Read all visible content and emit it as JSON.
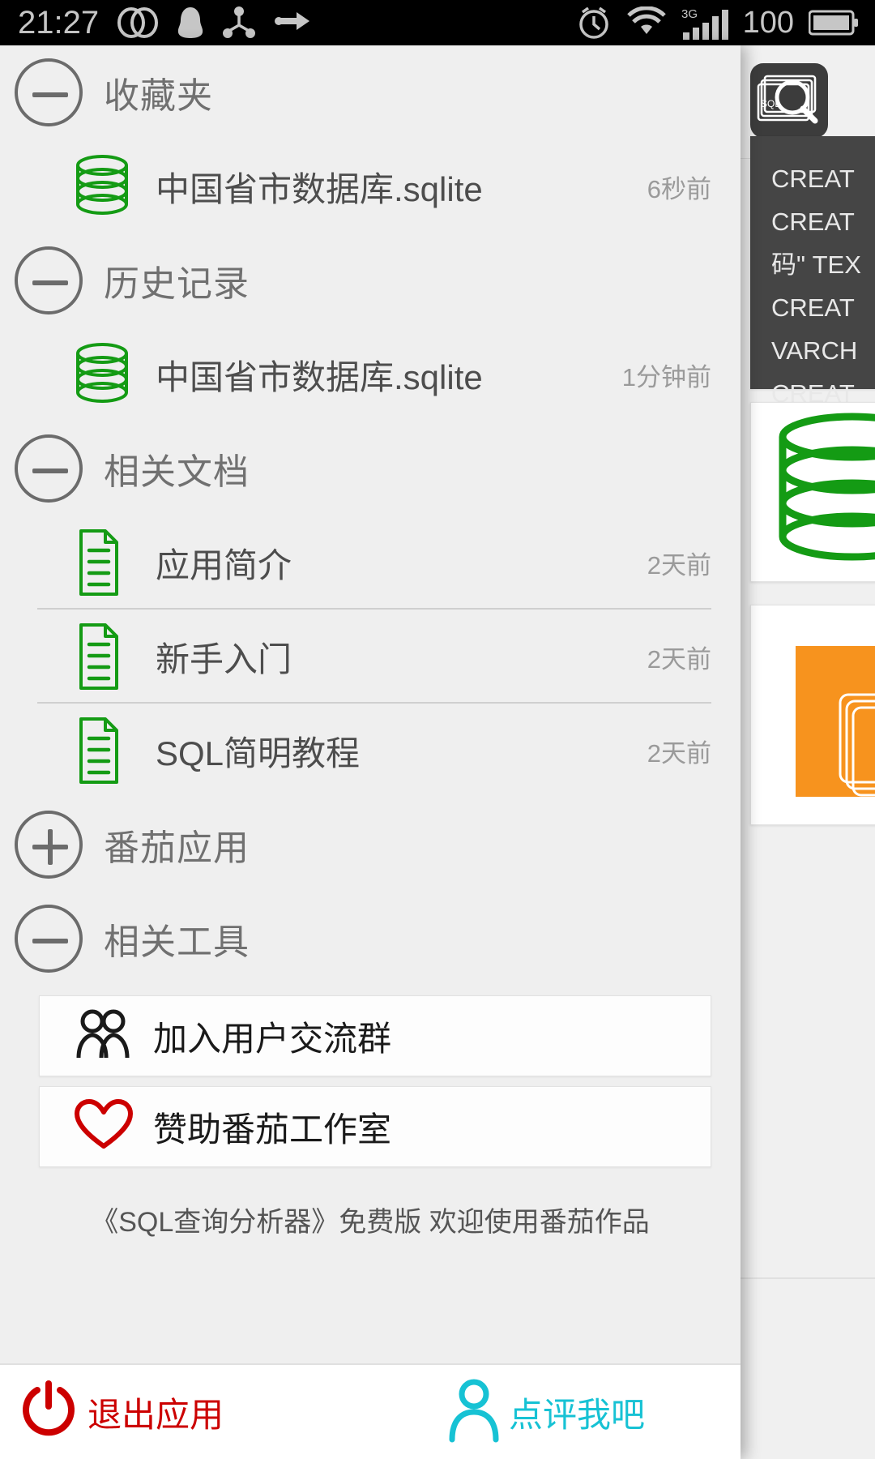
{
  "statusbar": {
    "time": "21:27",
    "battery_percent": "100",
    "network_type": "3G",
    "left_icons": [
      "dual-circle-icon",
      "qq-penguin-icon",
      "share-node-icon",
      "usb-transfer-icon"
    ],
    "right_icons": [
      "alarm-clock-icon",
      "wifi-icon",
      "signal-bars-icon",
      "battery-icon"
    ]
  },
  "drawer": {
    "groups": [
      {
        "id": "favorites",
        "title": "收藏夹",
        "toggle": "minus",
        "items": [
          {
            "icon": "database-icon",
            "label": "中国省市数据库.sqlite",
            "time": "6秒前",
            "separator": false
          }
        ]
      },
      {
        "id": "history",
        "title": "历史记录",
        "toggle": "minus",
        "items": [
          {
            "icon": "database-icon",
            "label": "中国省市数据库.sqlite",
            "time": "1分钟前",
            "separator": false
          }
        ]
      },
      {
        "id": "documents",
        "title": "相关文档",
        "toggle": "minus",
        "items": [
          {
            "icon": "document-icon",
            "label": "应用简介",
            "time": "2天前",
            "separator": true
          },
          {
            "icon": "document-icon",
            "label": "新手入门",
            "time": "2天前",
            "separator": true
          },
          {
            "icon": "document-icon",
            "label": "SQL简明教程",
            "time": "2天前",
            "separator": false
          }
        ]
      },
      {
        "id": "tomato-apps",
        "title": "番茄应用",
        "toggle": "plus",
        "items": []
      },
      {
        "id": "tools",
        "title": "相关工具",
        "toggle": "minus",
        "items": []
      }
    ],
    "tool_buttons": [
      {
        "icon": "two-people-icon",
        "label": "加入用户交流群",
        "color": "#1a1a1a"
      },
      {
        "icon": "heart-icon",
        "label": "赞助番茄工作室",
        "color": "#1a1a1a"
      }
    ],
    "promo_text": "《SQL查询分析器》免费版 欢迎使用番茄作品",
    "bottom_bar": {
      "exit": {
        "icon": "power-icon",
        "label": "退出应用",
        "color": "#cc0000"
      },
      "rate": {
        "icon": "person-icon",
        "label": "点评我吧",
        "color": "#17c2d4"
      }
    }
  },
  "behind_panel": {
    "app_icon": "sql-magnifier-icon",
    "app_icon_text": "SQL",
    "sql_lines": [
      "CREAT",
      "CREAT",
      "码\" TEX",
      "CREAT",
      "VARCH",
      "CREAT"
    ],
    "db_graphic": "database-cylinder-graphic",
    "orange_graphic": "orange-cards-graphic"
  },
  "colors": {
    "green": "#149b14",
    "red": "#cc0000",
    "cyan": "#17c2d4",
    "orange": "#f7931e",
    "grey_text": "#707070",
    "dark_panel": "#454545",
    "drawer_bg": "#efefef"
  }
}
